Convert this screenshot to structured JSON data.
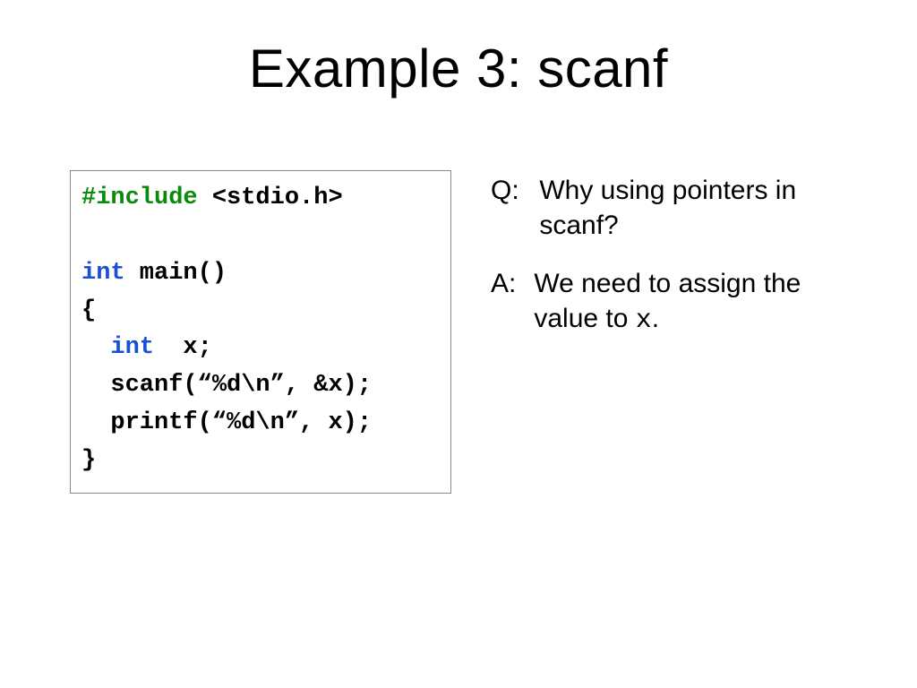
{
  "title": "Example 3: scanf",
  "code": {
    "l1a": "#include",
    "l1b": " <stdio.h>",
    "l3a": "int",
    "l3b": " main()",
    "l4": "{",
    "l5a": "int",
    "l5b": "  x;",
    "l6": "  scanf(“%d\\n”, &x);",
    "l7": "  printf(“%d\\n”, x);",
    "l8": "}"
  },
  "qa": {
    "q_label": "Q:",
    "q_text": "Why using pointers in scanf?",
    "a_label": "A:",
    "a_text_pre": "We need to assign the value to ",
    "a_text_x": "x",
    "a_text_post": "."
  }
}
